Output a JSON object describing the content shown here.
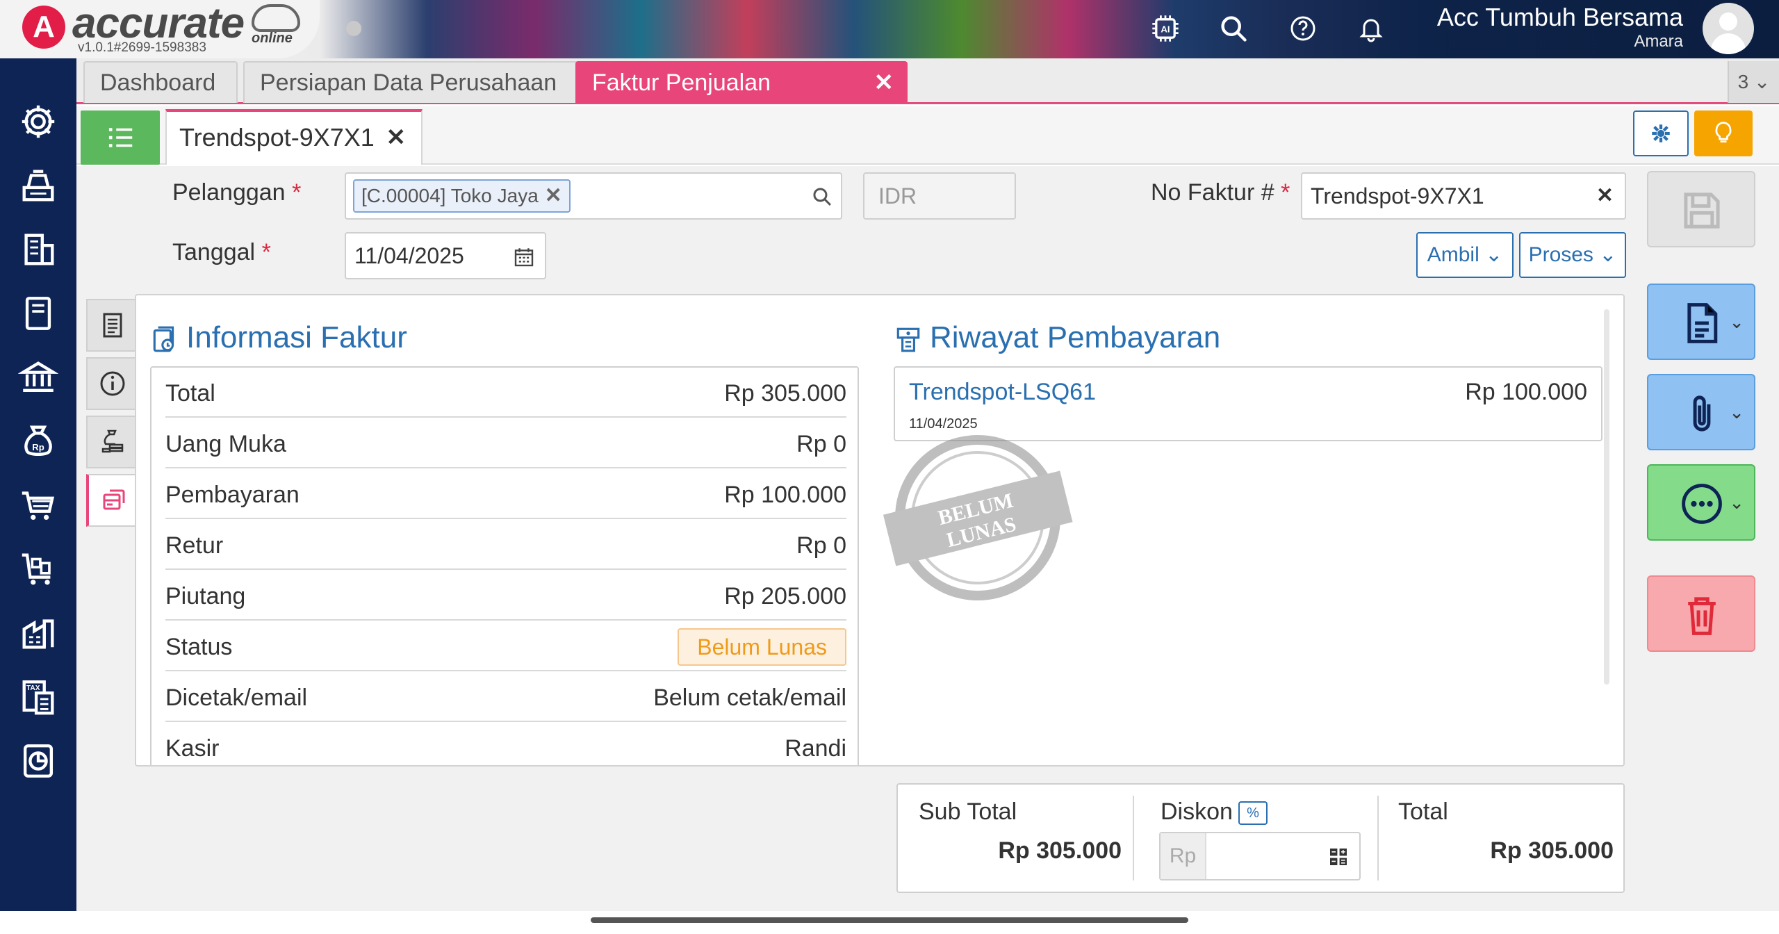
{
  "header": {
    "brand": "accurate",
    "brand_sub": "online",
    "version": "v1.0.1#2699-1598383",
    "company": "Acc Tumbuh Bersama",
    "user": "Amara",
    "icons": [
      "ai-chip-icon",
      "search-icon",
      "help-icon",
      "bell-icon"
    ]
  },
  "tabs": [
    {
      "label": "Dashboard"
    },
    {
      "label": "Persiapan Data Perusahaan"
    },
    {
      "label": "Faktur Penjualan",
      "active": true
    }
  ],
  "tabs_count": "3",
  "doc_tab": {
    "label": "Trendspot-9X7X1"
  },
  "form": {
    "customer_label": "Pelanggan",
    "customer_value": "[C.00004] Toko Jaya",
    "currency_placeholder": "IDR",
    "invoice_no_label": "No Faktur #",
    "invoice_no_value": "Trendspot-9X7X1",
    "date_label": "Tanggal",
    "date_value": "11/04/2025",
    "required_mark": "*",
    "ambil_label": "Ambil",
    "proses_label": "Proses"
  },
  "info": {
    "title": "Informasi Faktur",
    "rows": [
      {
        "key": "Total",
        "value": "Rp 305.000"
      },
      {
        "key": "Uang Muka",
        "value": "Rp 0"
      },
      {
        "key": "Pembayaran",
        "value": "Rp 100.000"
      },
      {
        "key": "Retur",
        "value": "Rp 0"
      },
      {
        "key": "Piutang",
        "value": "Rp 205.000"
      },
      {
        "key": "Status",
        "value": "Belum Lunas"
      },
      {
        "key": "Dicetak/email",
        "value": "Belum cetak/email"
      },
      {
        "key": "Kasir",
        "value": "Randi"
      }
    ]
  },
  "payments": {
    "title": "Riwayat Pembayaran",
    "items": [
      {
        "number": "Trendspot-LSQ61",
        "date": "11/04/2025",
        "amount": "Rp 100.000"
      }
    ],
    "stamp_line1": "BELUM",
    "stamp_line2": "LUNAS"
  },
  "totals": {
    "subtotal_label": "Sub Total",
    "subtotal_value": "Rp 305.000",
    "discount_label": "Diskon",
    "discount_pct": "%",
    "discount_prefix": "Rp",
    "total_label": "Total",
    "total_value": "Rp 305.000"
  },
  "colors": {
    "accent_pink": "#e8467a",
    "primary_blue": "#2a6fb0",
    "sidebar_navy": "#0e2455",
    "success_green": "#5cb85c",
    "warning_orange": "#f6a400",
    "danger_red": "#f5a3a8"
  }
}
